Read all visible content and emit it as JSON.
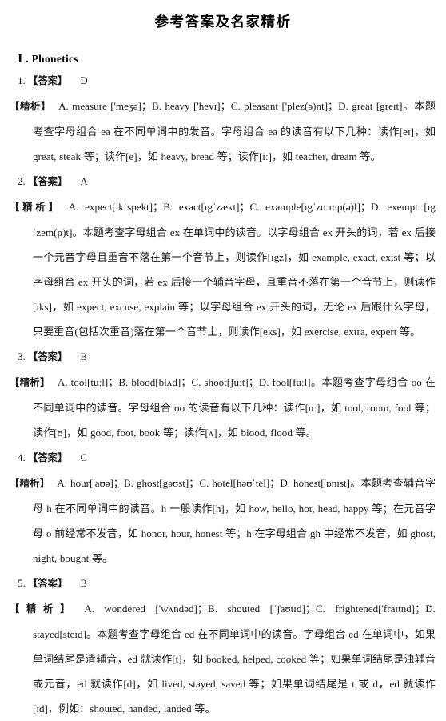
{
  "document": {
    "title": "参考答案及名家精析",
    "section_heading": "Ⅰ . Phonetics",
    "answer_label": "【答案】",
    "analysis_label": "【精析】"
  },
  "questions": [
    {
      "number": "1.",
      "answer": "D",
      "analysis": "A.  measure ['meʒə]；B.  heavy ['hevɪ]；C.  pleasant ['plez(ə)nt]；D.  great [greɪt]。本题考查字母组合 ea 在不同单词中的发音。字母组合 ea 的读音有以下几种：读作[eɪ]，如 great, steak 等；读作[e]，如 heavy, bread 等；读作[iː]，如 teacher, dream 等。"
    },
    {
      "number": "2.",
      "answer": "A",
      "analysis": "A. expect[ɪkˈspekt]；B.  exact[ɪgˈzækt]；C.  example[ɪgˈzɑːmp(ə)l]；D. exempt [ɪgˈzem(p)t]。本题考查字母组合 ex 在单词中的读音。以字母组合 ex 开头的词，若 ex 后接一个元音字母且重音不落在第一个音节上，则读作[ɪgz]，如 example, exact, exist 等；以字母组合 ex 开头的词，若 ex 后接一个辅音字母，且重音不落在第一个音节上，则读作[ɪks]，如 expect, excuse, explain 等；以字母组合 ex 开头的词，无论 ex 后跟什么字母，只要重音(包括次重音)落在第一个音节上，则读作[eks]，如 exercise, extra, expert 等。"
    },
    {
      "number": "3.",
      "answer": "B",
      "analysis": "A.  tool[tuːl]；B.  blood[blʌd]；C.  shoot[ʃuːt]；D.  fool[fuːl]。本题考查字母组合 oo 在不同单词中的读音。字母组合 oo 的读音有以下几种：读作[uː]，如 tool, room, fool 等；读作[ʊ]，如 good, foot, book 等；读作[ʌ]，如 blood, flood 等。"
    },
    {
      "number": "4.",
      "answer": "C",
      "analysis": "A.  hour['aʊə]；B.  ghost[gəʊst]；C.  hotel[həʊˈtel]；D.  honest['ɒnɪst]。本题考查辅音字母 h 在不同单词中的读音。h 一般读作[h]，如 how, hello, hot, head, happy 等；在元音字母 o 前经常不发音，如 honor, hour, honest 等；h 在字母组合 gh 中经常不发音，如 ghost, night, bought 等。"
    },
    {
      "number": "5.",
      "answer": "B",
      "analysis": "A.  wondered ['wʌndəd]；B.  shouted [ˈʃaʊtɪd]；C.  frightened['fraɪtnd]；D. stayed[steɪd]。本题考查字母组合 ed 在不同单词中的读音。字母组合 ed 在单词中，如果单词结尾是清辅音，ed 就读作[t]，如 booked, helped, cooked 等；如果单词结尾是浊辅音或元音，ed 就读作[d]，如 lived, stayed, saved 等；如果单词结尾是 t 或 d，ed 就读作[ɪd]，例如：shouted, handed, landed 等。"
    }
  ]
}
